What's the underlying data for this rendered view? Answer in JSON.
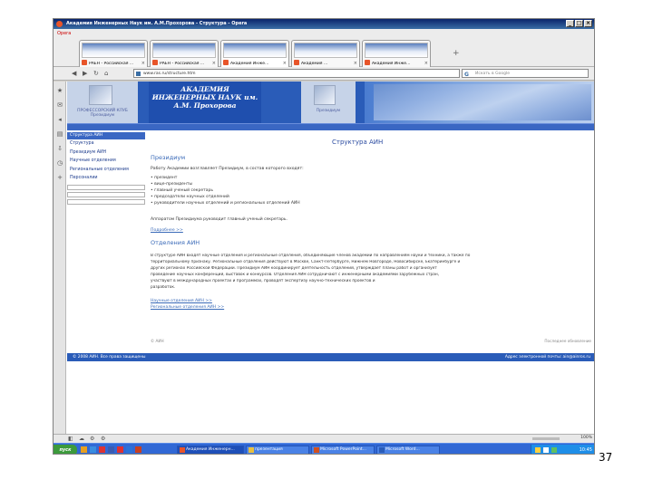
{
  "window": {
    "title": "Академия Инженерных Наук им. А.М.Прохорова - Структура - Opera",
    "buttons": [
      "_",
      "□",
      "×"
    ]
  },
  "browser": {
    "menu_label": "Opera",
    "tabs": [
      {
        "label": "РАЕН - Российская ..."
      },
      {
        "label": "РАЕН - Российская ..."
      },
      {
        "label": "Академия Инже..."
      },
      {
        "label": "Академия ..."
      },
      {
        "label": "Академия Инже..."
      }
    ],
    "new_tab": "+",
    "address": "www.ras.ru/structure.htm",
    "search_placeholder": "Искать в Google",
    "status_zoom": "100%"
  },
  "site": {
    "title": "АКАДЕМИЯ ИНЖЕНЕРНЫХ НАУК им. А.М. Прохорова",
    "header_caption_left": "ПРОФЕССОРСКИЙ КЛУБ Президиум",
    "header_caption_right": "Президиум",
    "nav": [
      "Главная страница",
      "Информация",
      "Структура АИН",
      "Проекты",
      "Членство в АИН",
      "Форум",
      "Поиск",
      "English"
    ],
    "sidebar": {
      "title": "Структура АИН",
      "items": [
        "Структура",
        "Президиум АИН",
        "Научные отделения",
        "Региональные отделения",
        "Персоналии"
      ]
    },
    "content": {
      "heading": "Структура АИН",
      "section1_title": "Президиум",
      "intro": "Работу Академии возглавляет Президиум, в состав которого входят:",
      "list": [
        "• президент",
        "• вице-президенты",
        "• главный ученый секретарь",
        "• председатели научных отделений",
        "• руководители научных отделений и региональных отделений АИН"
      ],
      "closing": "Аппаратом Президиума руководит главный ученый секретарь.",
      "more1": "Подробнее >>",
      "section2_title": "Отделения АИН",
      "paragraph": [
        "В структуре АИН входят научные отделения и региональные отделения, объединяющие членов академии по направлениям науки и техники, а также по",
        "территориальному признаку. Региональные отделения действуют в Москве, Санкт-Петербурге, Нижнем Новгороде, Новосибирске, Екатеринбурге и",
        "других регионах Российской Федерации. Президиум АИН координирует деятельность отделений, утверждает планы работ и организует",
        "проведение научных конференций, выставок и конкурсов. Отделения АИН сотрудничают с инженерными академиями зарубежных стран,",
        "участвуют в международных проектах и программах, проводят экспертизу научно-технических проектов и",
        "разработок."
      ],
      "links": [
        "Научные отделения АИН >>",
        "Региональные отделения АИН >>"
      ]
    },
    "footer_meta_left": "© АИН",
    "footer_meta_right": "Последнее обновление",
    "footer_copy": "© 2008 АИН. Все права защищены",
    "footer_mail": "Адрес электронной почты: ain@ainros.ru"
  },
  "taskbar": {
    "start_label": "пуск",
    "tasks": [
      {
        "label": "Академия Инженерн..."
      },
      {
        "label": "презентация"
      },
      {
        "label": "Microsoft PowerPoint..."
      },
      {
        "label": "Microsoft Word..."
      }
    ],
    "clock": "10:45"
  },
  "slide_number": "37",
  "colors": {
    "site_blue": "#2a5cb8",
    "link_blue": "#3a6ab8",
    "taskbar_blue": "#3168d5",
    "start_green": "#3c9a3c"
  }
}
